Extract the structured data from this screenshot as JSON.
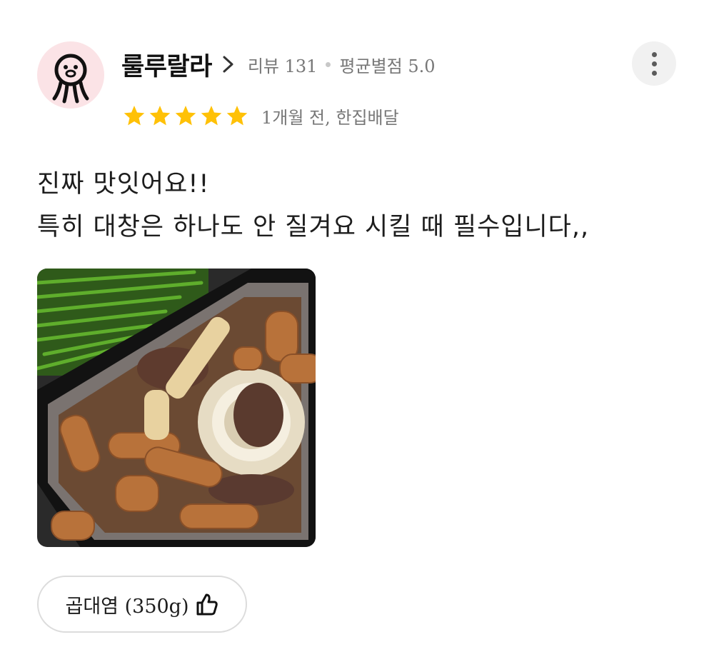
{
  "review": {
    "user": {
      "name": "룰루랄라",
      "review_count_label": "리뷰 131",
      "avg_rating_label": "평균별점 5.0",
      "avatar_icon": "octopus-face-icon"
    },
    "rating": {
      "stars": 5,
      "max": 5,
      "color": "#ffc107"
    },
    "time_label": "1개월 전, 한집배달",
    "text_lines": [
      "진짜 맛잇어요!!",
      "특히 대창은 하나도 안 질겨요 시킬 때 필수입니다,,"
    ],
    "photo_icon": "food-photo",
    "menu_tag": {
      "label": "곱대염 (350g)",
      "icon": "thumbs-up-icon"
    },
    "more_icon": "more-vertical-icon"
  }
}
